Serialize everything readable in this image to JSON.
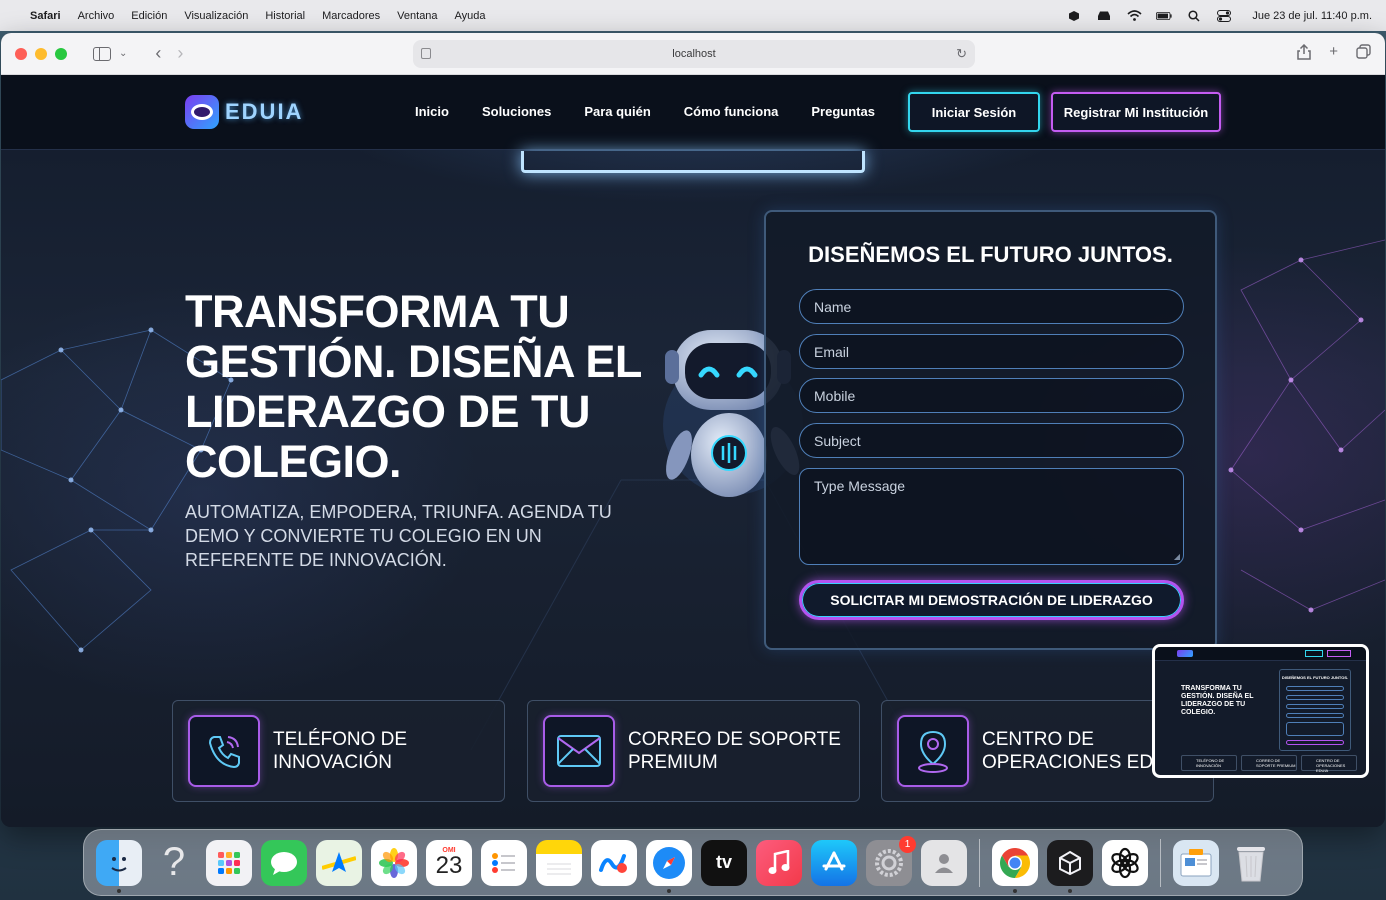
{
  "menubar": {
    "app": "Safari",
    "items": [
      "Archivo",
      "Edición",
      "Visualización",
      "Historial",
      "Marcadores",
      "Ventana",
      "Ayuda"
    ],
    "clock": "Jue 23 de jul.  11:40 p.m."
  },
  "browser": {
    "url": "localhost"
  },
  "site": {
    "logo": "EDUIA",
    "nav": [
      "Inicio",
      "Soluciones",
      "Para quién",
      "Cómo funciona",
      "Preguntas"
    ],
    "login_label": "Iniciar Sesión",
    "register_label": "Registrar Mi Institución"
  },
  "hero": {
    "title": "TRANSFORMA TU GESTIÓN. DISEÑA EL LIDERAZGO DE TU COLEGIO.",
    "subtitle": "AUTOMATIZA, EMPODERA, TRIUNFA. AGENDA TU DEMO Y CONVIERTE TU COLEGIO EN UN REFERENTE DE INNOVACIÓN."
  },
  "form": {
    "title": "DISEÑEMOS EL FUTURO JUNTOS.",
    "name_placeholder": "Name",
    "email_placeholder": "Email",
    "mobile_placeholder": "Mobile",
    "subject_placeholder": "Subject",
    "message_placeholder": "Type Message",
    "submit_label": "SOLICITAR MI DEMOSTRACIÓN DE LIDERAZGO"
  },
  "contacts": [
    {
      "label": "TELÉFONO DE\nINNOVACIÓN",
      "icon": "phone-icon"
    },
    {
      "label": "CORREO DE SOPORTE\nPREMIUM",
      "icon": "mail-icon"
    },
    {
      "label": "CENTRO DE\nOPERACIONES EDUIA",
      "icon": "location-pin-icon"
    }
  ],
  "pip_preview": {
    "title": "TRANSFORMA TU GESTIÓN. DISEÑA EL LIDERAZGO DE TU COLEGIO.",
    "form_title": "DISEÑEMOS EL FUTURO JUNTOS.",
    "cards": [
      "TELÉFONO DE INNOVACIÓN",
      "CORREO DE SOPORTE PREMIUM",
      "CENTRO DE OPERACIONES EDUIA"
    ]
  },
  "dock": {
    "calendar_month": "OMI",
    "calendar_day": "23",
    "appletv_label": "tv",
    "settings_badge": "1",
    "apps": [
      "finder-icon",
      "help-icon",
      "launchpad-icon",
      "messages-icon",
      "maps-icon",
      "photos-icon",
      "calendar-icon",
      "reminders-icon",
      "notes-icon",
      "freeform-icon",
      "safari-icon",
      "appletv-icon",
      "music-icon",
      "appstore-icon",
      "settings-icon",
      "contacts-icon",
      "chrome-icon",
      "perplexity-icon",
      "chatgpt-icon",
      "preview-icon",
      "trash-icon"
    ]
  },
  "colors": {
    "accent_cyan": "#33d6ee",
    "accent_purple": "#c45cf2",
    "page_bg": "#131c2c"
  }
}
